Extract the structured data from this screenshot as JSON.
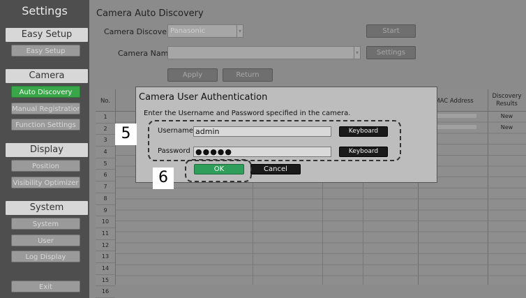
{
  "sidebar": {
    "title": "Settings",
    "sections": [
      {
        "label": "Easy Setup"
      },
      {
        "label": "Camera"
      },
      {
        "label": "Display"
      },
      {
        "label": "System"
      }
    ],
    "items": [
      {
        "label": "Easy Setup"
      },
      {
        "label": "Auto Discovery"
      },
      {
        "label": "Manual Registration"
      },
      {
        "label": "Function Settings"
      },
      {
        "label": "Position"
      },
      {
        "label": "Visibility Optimizer"
      },
      {
        "label": "System"
      },
      {
        "label": "User"
      },
      {
        "label": "Log Display"
      }
    ],
    "exit_label": "Exit"
  },
  "main": {
    "title": "Camera Auto Discovery",
    "discovery_label": "Camera Discovery",
    "discovery_value": "Panasonic",
    "start_label": "Start",
    "camera_name_label": "Camera Name",
    "camera_name_value": "",
    "settings_label": "Settings",
    "apply_label": "Apply",
    "return_label": "Return"
  },
  "table": {
    "no_header": "No.",
    "mac_header": "MAC Address",
    "results_header": "Discovery Results",
    "rows": [
      "1",
      "2",
      "3",
      "4",
      "5",
      "6",
      "7",
      "8",
      "9",
      "10",
      "11",
      "12",
      "13",
      "14",
      "15",
      "16"
    ],
    "results": [
      "New",
      "New"
    ]
  },
  "dialog": {
    "title": "Camera User Authentication",
    "instruction": "Enter the Username and Password specified in the camera.",
    "username_label": "Username :",
    "username_value": "admin",
    "password_label": "Password :",
    "password_value": "●●●●●",
    "keyboard_label": "Keyboard",
    "ok_label": "OK",
    "cancel_label": "Cancel"
  },
  "callouts": {
    "one": "5",
    "two": "6"
  },
  "colors": {
    "active_green": "#3aa64a",
    "ok_green": "#2f9e5a"
  }
}
